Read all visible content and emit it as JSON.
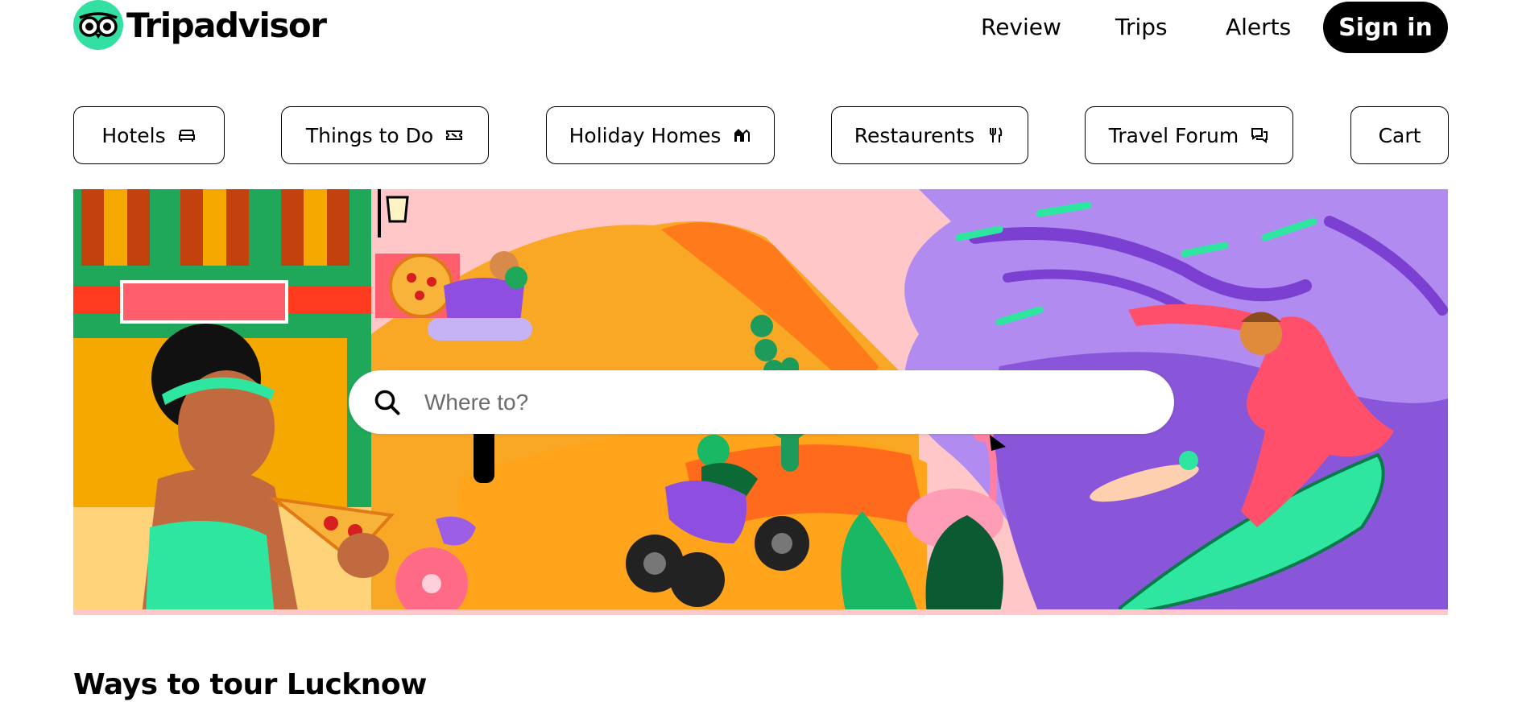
{
  "brand": {
    "name": "Tripadvisor",
    "accent": "#34e0a1"
  },
  "topnav": {
    "review": "Review",
    "trips": "Trips",
    "alerts": "Alerts",
    "signin": "Sign in"
  },
  "categories": [
    {
      "label": "Hotels",
      "icon": "bed-icon"
    },
    {
      "label": "Things to Do",
      "icon": "ticket-icon"
    },
    {
      "label": "Holiday Homes",
      "icon": "house-icon"
    },
    {
      "label": "Restaurents",
      "icon": "utensils-icon"
    },
    {
      "label": "Travel Forum",
      "icon": "chat-icon"
    },
    {
      "label": "Cart",
      "icon": ""
    }
  ],
  "search": {
    "placeholder": "Where to?"
  },
  "section": {
    "title": "Ways to tour Lucknow"
  }
}
